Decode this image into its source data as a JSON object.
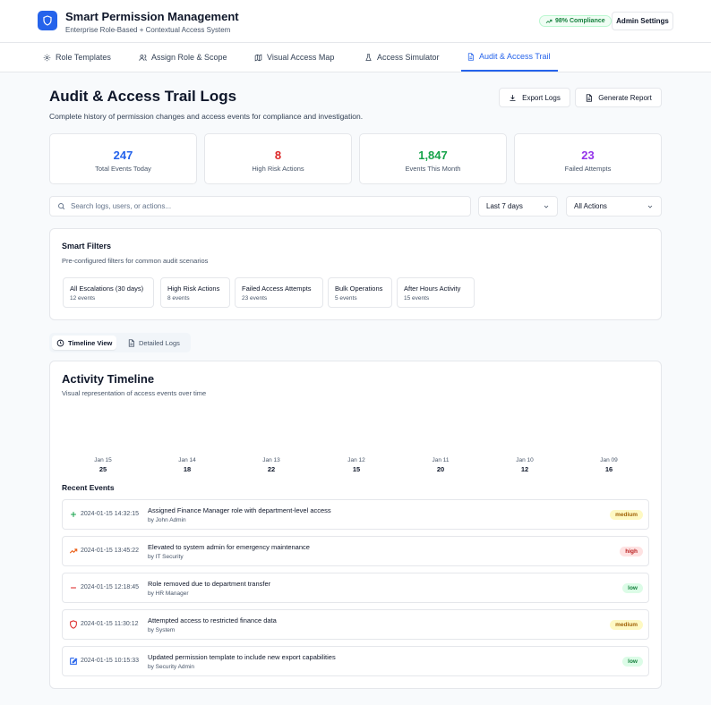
{
  "header": {
    "title": "Smart Permission Management",
    "subtitle": "Enterprise Role-Based + Contextual Access System",
    "compliance": "98% Compliance",
    "admin_label": "Admin Settings"
  },
  "tabs": [
    {
      "label": "Role Templates",
      "icon": "gear-icon"
    },
    {
      "label": "Assign Role & Scope",
      "icon": "users-icon"
    },
    {
      "label": "Visual Access Map",
      "icon": "map-icon"
    },
    {
      "label": "Access Simulator",
      "icon": "flask-icon"
    },
    {
      "label": "Audit & Access Trail",
      "icon": "document-icon",
      "active": true
    }
  ],
  "page": {
    "title": "Audit & Access Trail Logs",
    "description": "Complete history of permission changes and access events for compliance and investigation.",
    "export_label": "Export Logs",
    "report_label": "Generate Report"
  },
  "stats": [
    {
      "value": "247",
      "label": "Total Events Today",
      "color": "#2563eb"
    },
    {
      "value": "8",
      "label": "High Risk Actions",
      "color": "#dc2626"
    },
    {
      "value": "1,847",
      "label": "Events This Month",
      "color": "#16a34a"
    },
    {
      "value": "23",
      "label": "Failed Attempts",
      "color": "#9333ea"
    }
  ],
  "search": {
    "placeholder": "Search logs, users, or actions...",
    "range": "Last 7 days",
    "actions": "All Actions"
  },
  "smart_filters": {
    "title": "Smart Filters",
    "subtitle": "Pre-configured filters for common audit scenarios",
    "items": [
      {
        "label": "All Escalations (30 days)",
        "count": "12 events"
      },
      {
        "label": "High Risk Actions",
        "count": "8 events"
      },
      {
        "label": "Failed Access Attempts",
        "count": "23 events"
      },
      {
        "label": "Bulk Operations",
        "count": "5 events"
      },
      {
        "label": "After Hours Activity",
        "count": "15 events"
      }
    ]
  },
  "views": {
    "timeline": "Timeline View",
    "detailed": "Detailed Logs",
    "active": "timeline"
  },
  "timeline": {
    "title": "Activity Timeline",
    "subtitle": "Visual representation of access events over time",
    "days": [
      {
        "date": "Jan 15",
        "count": "25"
      },
      {
        "date": "Jan 14",
        "count": "18"
      },
      {
        "date": "Jan 13",
        "count": "22"
      },
      {
        "date": "Jan 12",
        "count": "15"
      },
      {
        "date": "Jan 11",
        "count": "20"
      },
      {
        "date": "Jan 10",
        "count": "12"
      },
      {
        "date": "Jan 09",
        "count": "16"
      }
    ]
  },
  "recent": {
    "title": "Recent Events",
    "events": [
      {
        "icon": "plus-icon",
        "icon_color": "#16a34a",
        "time": "2024-01-15 14:32:15",
        "message": "Assigned Finance Manager role with department-level access",
        "by": "by John Admin",
        "risk": "medium"
      },
      {
        "icon": "trending-up-icon",
        "icon_color": "#ea580c",
        "time": "2024-01-15 13:45:22",
        "message": "Elevated to system admin for emergency maintenance",
        "by": "by IT Security",
        "risk": "high"
      },
      {
        "icon": "minus-icon",
        "icon_color": "#dc2626",
        "time": "2024-01-15 12:18:45",
        "message": "Role removed due to department transfer",
        "by": "by HR Manager",
        "risk": "low"
      },
      {
        "icon": "shield-icon",
        "icon_color": "#dc2626",
        "time": "2024-01-15 11:30:12",
        "message": "Attempted access to restricted finance data",
        "by": "by System",
        "risk": "medium"
      },
      {
        "icon": "edit-icon",
        "icon_color": "#2563eb",
        "time": "2024-01-15 10:15:33",
        "message": "Updated permission template to include new export capabilities",
        "by": "by Security Admin",
        "risk": "low"
      }
    ]
  },
  "risk_colors": {
    "low": {
      "bg": "#dcfce7",
      "fg": "#15803d"
    },
    "medium": {
      "bg": "#fef9c3",
      "fg": "#a16207"
    },
    "high": {
      "bg": "#fee2e2",
      "fg": "#b91c1c"
    }
  }
}
